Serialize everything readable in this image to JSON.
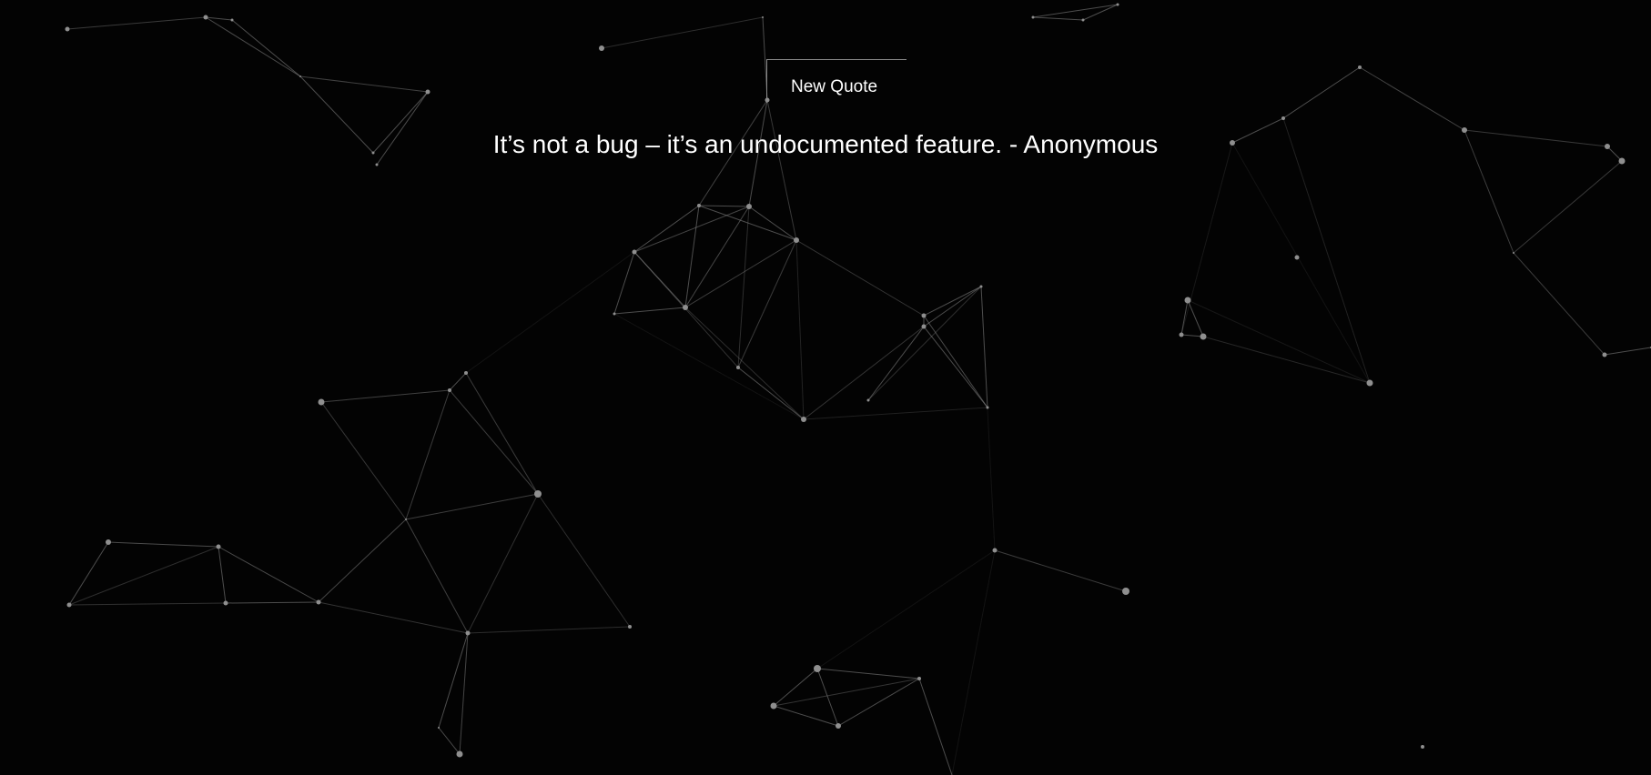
{
  "page": {
    "background_color": "#030303"
  },
  "background": {
    "kind": "particle-network",
    "line_color": "#8a8a8a",
    "node_color": "#8f8f8f"
  },
  "controls": {
    "new_quote_label": "New Quote"
  },
  "quote": {
    "text": "It’s not a bug – it’s an undocumented feature. - Anonymous"
  }
}
